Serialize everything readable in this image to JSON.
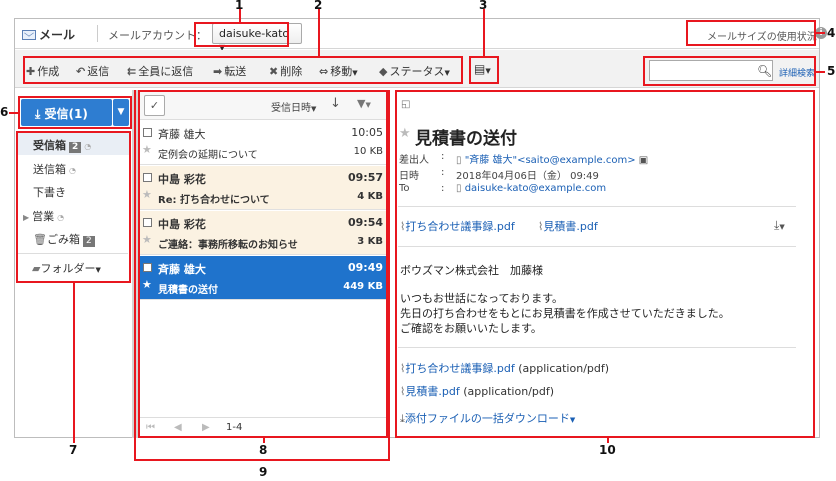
{
  "header": {
    "app_title": "メール",
    "account_label": "メールアカウント：",
    "account_value": "daisuke-kato",
    "usage_link": "メールサイズの使用状況"
  },
  "toolbar": {
    "compose": "作成",
    "reply": "返信",
    "reply_all": "全員に返信",
    "forward": "転送",
    "delete": "削除",
    "move": "移動",
    "status": "ステータス",
    "search_placeholder": "",
    "advanced_search": "詳細検索"
  },
  "sidebar": {
    "receive_button": "受信(1)",
    "folders": [
      {
        "label": "受信箱",
        "badge": "2",
        "rss": true
      },
      {
        "label": "送信箱",
        "badge": "",
        "rss": true
      },
      {
        "label": "下書き",
        "badge": "",
        "rss": false
      },
      {
        "label": "営業",
        "badge": "",
        "rss": true
      },
      {
        "label": "ごみ箱",
        "badge": "2",
        "rss": false
      }
    ],
    "folder_menu": "フォルダー"
  },
  "message_list": {
    "sort_label": "受信日時",
    "items": [
      {
        "from": "斉藤 雄大",
        "time": "10:05",
        "subject": "定例会の延期について",
        "size": "10 KB"
      },
      {
        "from": "中島 彩花",
        "time": "09:57",
        "subject": "Re: 打ち合わせについて",
        "size": "4 KB"
      },
      {
        "from": "中島 彩花",
        "time": "09:54",
        "subject": "ご連絡：事務所移転のお知らせ",
        "size": "3 KB"
      },
      {
        "from": "斉藤 雄大",
        "time": "09:49",
        "subject": "見積書の送付",
        "size": "449 KB"
      }
    ],
    "pager_count": "1-4"
  },
  "detail": {
    "subject": "見積書の送付",
    "from_label": "差出人",
    "from_value": "\"斉藤 雄大\"<saito@example.com>",
    "date_label": "日時",
    "date_value": "2018年04月06日（金） 09:49",
    "to_label": "To",
    "to_value": "daisuke-kato@example.com",
    "attachments": [
      "打ち合わせ議事録.pdf",
      "見積書.pdf"
    ],
    "body": [
      "ボウズマン株式会社　加藤様",
      "",
      "いつもお世話になっております。",
      "先日の打ち合わせをもとにお見積書を作成させていただきました。",
      "ご確認をお願いいたします。"
    ],
    "attachment_details": [
      {
        "name": "打ち合わせ議事録.pdf",
        "type": "(application/pdf)"
      },
      {
        "name": "見積書.pdf",
        "type": "(application/pdf)"
      }
    ],
    "download_all": "添付ファイルの一括ダウンロード"
  },
  "callouts": {
    "n1": "1",
    "n2": "2",
    "n3": "3",
    "n4": "4",
    "n5": "5",
    "n6": "6",
    "n7": "7",
    "n8": "8",
    "n9": "9",
    "n10": "10"
  },
  "colors": {
    "annotation_red": "#e8171f",
    "primary_blue": "#2e7dd1",
    "selected_row": "#1f73cc",
    "unread_row": "#fbf2e2",
    "link": "#1a5fb4"
  }
}
